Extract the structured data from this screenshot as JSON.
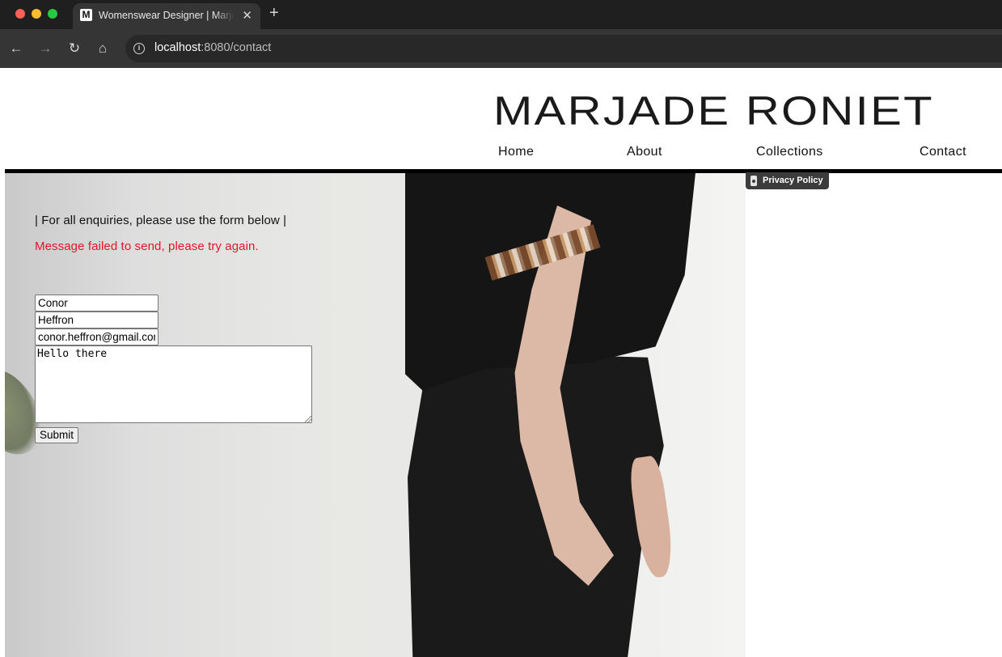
{
  "browser": {
    "tab": {
      "favicon": "M",
      "title": "Womenswear Designer | Marjade Roniet",
      "close": "✕"
    },
    "new_tab": "+",
    "icons": {
      "back": "←",
      "forward": "→",
      "reload": "↻",
      "home": "⌂",
      "info": "i"
    },
    "url": {
      "host": "localhost",
      "path": ":8080/contact"
    }
  },
  "site": {
    "brand": "MARJADE RONIET",
    "nav": {
      "home": "Home",
      "about": "About",
      "collections": "Collections",
      "contact": "Contact"
    }
  },
  "contact": {
    "intro": "| For all enquiries, please use the form below |",
    "error": "Message failed to send, please try again.",
    "colors": {
      "error": "#e8122c"
    },
    "form": {
      "first_name": "Conor",
      "last_name": "Heffron",
      "email": "conor.heffron@gmail.com",
      "message": "Hello there",
      "submit": "Submit"
    }
  },
  "privacy_badge": {
    "label": "Privacy Policy",
    "icon": "lock-icon"
  }
}
